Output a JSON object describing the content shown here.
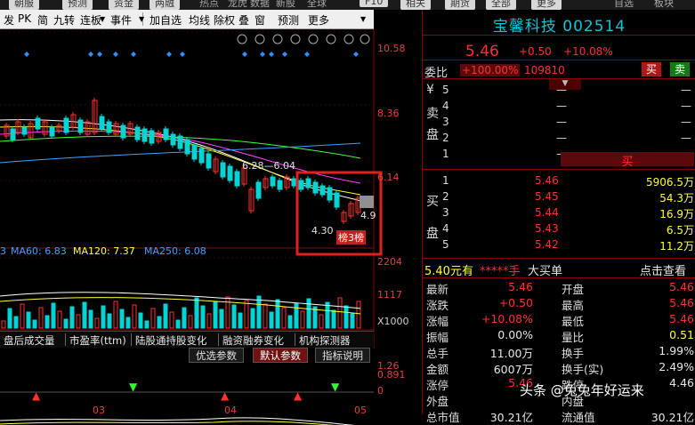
{
  "top_strip": {
    "items": [
      "朝服",
      "预测",
      "资金",
      "两融",
      "热点",
      "龙虎",
      "数据",
      "新股",
      "全球",
      "F10",
      "相关",
      "期货",
      "全部",
      "更多",
      "自选",
      "板块"
    ]
  },
  "toolbar": {
    "items": [
      "发",
      "PK",
      "简",
      "九转",
      "连板",
      "事件",
      "加自选",
      "均线",
      "除权",
      "叠",
      "窗",
      "预测",
      "更多"
    ]
  },
  "chart": {
    "price_labels": [
      "10.58",
      "8.36",
      "6.14"
    ],
    "volume_labels": [
      "2204",
      "1117",
      "X1000"
    ],
    "macd_labels": [
      "1.26",
      "0.891",
      "0"
    ],
    "peak_label": "6.28",
    "peak_label2": "6.04",
    "low_label": "4.30",
    "right_label": "4.9",
    "badge": "榜",
    "badge2": "榜",
    "date_labels": [
      "03",
      "04",
      "05"
    ],
    "ma_legend": [
      {
        "text": "MA60: 6.83",
        "color": "#40a0ff"
      },
      {
        "text": "MA120: 7.37",
        "color": "#ffff40"
      },
      {
        "text": "MA250: 6.08",
        "color": "#40a0ff"
      }
    ],
    "ma_prefix": "3"
  },
  "indicator_tabs": [
    "盘后成交量",
    "市盈率(ttm)",
    "陆股通持股变化",
    "融资融券变化",
    "机构探测器"
  ],
  "sub_tabs": {
    "items": [
      "优选参数",
      "默认参数",
      "指标说明"
    ],
    "active": 1
  },
  "quote": {
    "name": "宝馨科技",
    "code": "002514",
    "price": "5.46",
    "change": "+0.50",
    "change_pct": "+10.08%",
    "weibi_label": "委比",
    "weibi_value": "+100.00%",
    "weibi_count": "109810",
    "buy_btn": "买",
    "sell_btn": "卖",
    "sell_label": [
      "¥",
      "卖",
      "盘"
    ],
    "buy_label": [
      "买",
      "盘"
    ],
    "sell_rows": [
      {
        "level": "5",
        "price": "",
        "vol": "—"
      },
      {
        "level": "4",
        "price": "",
        "vol": "—"
      },
      {
        "level": "3",
        "price": "",
        "vol": "—"
      },
      {
        "level": "2",
        "price": "",
        "vol": "—"
      },
      {
        "level": "1",
        "price": "",
        "vol": "—"
      }
    ],
    "limit_marker": "买",
    "buy_rows": [
      {
        "level": "1",
        "price": "5.46",
        "vol": "5906.5万"
      },
      {
        "level": "2",
        "price": "5.45",
        "vol": "54.3万"
      },
      {
        "level": "3",
        "price": "5.44",
        "vol": "16.9万"
      },
      {
        "level": "4",
        "price": "5.43",
        "vol": "6.5万"
      },
      {
        "level": "5",
        "price": "5.42",
        "vol": "11.2万"
      }
    ],
    "big_order": {
      "price": "5.40元有",
      "stars": "*****手",
      "label": "大买单",
      "link": "点击查看"
    },
    "stats": [
      {
        "l1": "最新",
        "v1": "5.46",
        "c1": "red",
        "l2": "开盘",
        "v2": "5.46",
        "c2": "red"
      },
      {
        "l1": "涨跌",
        "v1": "+0.50",
        "c1": "red",
        "l2": "最高",
        "v2": "5.46",
        "c2": "red"
      },
      {
        "l1": "涨幅",
        "v1": "+10.08%",
        "c1": "red",
        "l2": "最低",
        "v2": "5.46",
        "c2": "red"
      },
      {
        "l1": "振幅",
        "v1": "0.00%",
        "c1": "white",
        "l2": "量比",
        "v2": "0.51",
        "c2": "yellow"
      },
      {
        "l1": "总手",
        "v1": "11.00万",
        "c1": "white",
        "l2": "换手",
        "v2": "1.99%",
        "c2": "white"
      },
      {
        "l1": "金额",
        "v1": "6007万",
        "c1": "white",
        "l2": "换手(实)",
        "v2": "2.49%",
        "c2": "white"
      },
      {
        "l1": "涨停",
        "v1": "5.46",
        "c1": "red",
        "l2": "跌停",
        "v2": "4.46",
        "c2": "white"
      },
      {
        "l1": "外盘",
        "v1": "",
        "c1": "white",
        "l2": "内盘",
        "v2": "",
        "c2": "white"
      }
    ],
    "bottom_partial": {
      "l1": "总市值",
      "v1": "30.21亿",
      "l2": "流通值",
      "v2": "30.21亿"
    }
  },
  "watermark": "头条 @兔兔年好运来",
  "colors": {
    "up": "#ff3030",
    "down": "#00d4d4",
    "accent_border": "#e02020",
    "ma5": "#ffffff",
    "ma10": "#ffff40",
    "ma20": "#ff40ff",
    "ma30": "#40ff40"
  }
}
